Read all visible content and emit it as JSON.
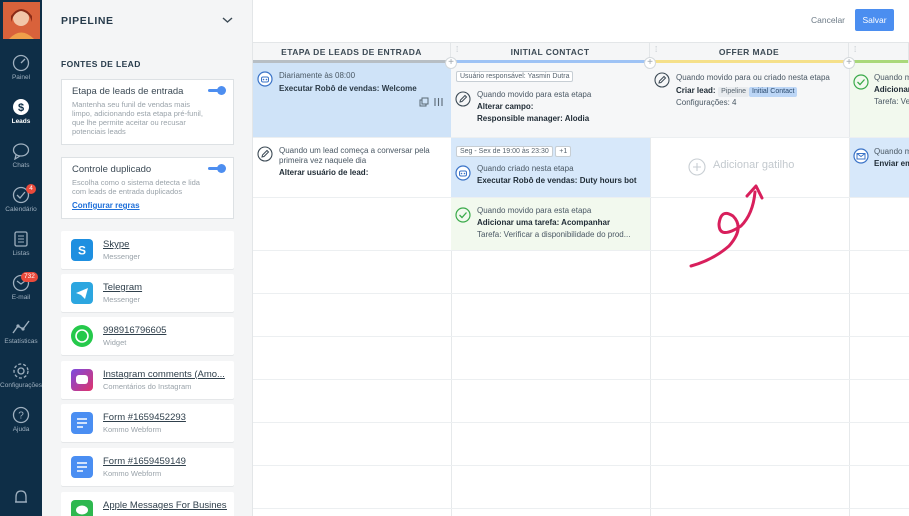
{
  "pipeline": {
    "title": "PIPELINE"
  },
  "nav": [
    {
      "label": "Painel",
      "icon": "dashboard-icon"
    },
    {
      "label": "Leads",
      "icon": "leads-icon",
      "active": true
    },
    {
      "label": "Chats",
      "icon": "chat-icon"
    },
    {
      "label": "Calendário",
      "icon": "calendar-check-icon",
      "badge": "4"
    },
    {
      "label": "Listas",
      "icon": "list-icon"
    },
    {
      "label": "E-mail",
      "icon": "mail-icon",
      "badge": "732"
    },
    {
      "label": "Estatísticas",
      "icon": "stats-icon"
    },
    {
      "label": "Configurações",
      "icon": "settings-icon"
    },
    {
      "label": "Ajuda",
      "icon": "help-icon"
    }
  ],
  "sources": {
    "title": "FONTES DE LEAD",
    "incoming_box": {
      "title": "Etapa de leads de entrada",
      "description": "Mantenha seu funil de vendas mais limpo, adicionando esta etapa pré-funil, que lhe permite aceitar ou recusar potenciais leads"
    },
    "duplicate_box": {
      "title": "Controle duplicado",
      "description": "Escolha como o sistema detecta e lida com leads de entrada duplicados",
      "link": "Configurar regras"
    },
    "items": [
      {
        "name": "Skype",
        "sub": "Messenger",
        "icon": "skype-icon",
        "color": "#1e8fe0"
      },
      {
        "name": "Telegram",
        "sub": "Messenger",
        "icon": "telegram-icon",
        "color": "#2ca6e0"
      },
      {
        "name": "998916796605",
        "sub": "Widget",
        "icon": "whatsapp-icon",
        "color": "#25c94b"
      },
      {
        "name": "Instagram comments (Amo...",
        "sub": "Comentários do Instagram",
        "icon": "instagram-icon",
        "color": "#d63a7a"
      },
      {
        "name": "Form #1659452293",
        "sub": "Kommo Webform",
        "icon": "form-icon",
        "color": "#4a8ef2"
      },
      {
        "name": "Form #1659459149",
        "sub": "Kommo Webform",
        "icon": "form-icon",
        "color": "#4a8ef2"
      },
      {
        "name": "Apple Messages For Business",
        "sub": "",
        "icon": "apple-messages-icon",
        "color": "#2eb84f"
      }
    ]
  },
  "header": {
    "cancel": "Cancelar",
    "save": "Salvar"
  },
  "columns": [
    {
      "title": "ETAPA DE LEADS DE ENTRADA",
      "color": "#b7bec4"
    },
    {
      "title": "INITIAL CONTACT",
      "color": "#9ec3f5"
    },
    {
      "title": "OFFER MADE",
      "color": "#f5e08a"
    },
    {
      "title": "",
      "color": "#a9d87a"
    }
  ],
  "triggers": {
    "c0r0": {
      "line1": "Diariamente às 08:00",
      "line2": "Executar Robô de vendas: Welcome"
    },
    "c0r1": {
      "line1": "Quando um lead começa a conversar pela",
      "line1b": "primeira vez naquele dia",
      "line2": "Alterar usuário de lead:"
    },
    "c1r0": {
      "tag": "Usuário responsável: Yasmin Dutra",
      "line1": "Quando movido para esta etapa",
      "line2": "Alterar campo:",
      "line3": "Responsible manager: Alodia"
    },
    "c1r1": {
      "tag": "Seg - Sex de 19:00 às 23:30",
      "tag2": "+1",
      "line1": "Quando criado nesta etapa",
      "line2": "Executar Robô de vendas: Duty hours bot"
    },
    "c1r2": {
      "line1": "Quando movido para esta etapa",
      "line2": "Adicionar uma tarefa: Acompanhar",
      "line3": "Tarefa: Verificar a disponibilidade do prod..."
    },
    "c2r0": {
      "line1": "Quando movido para ou criado nesta etapa",
      "line2": "Criar lead:",
      "pill1": "Pipeline",
      "pill2": "Initial Contact",
      "line3": "Configurações: 4"
    },
    "c2r1": {
      "add": "Adicionar gatilho"
    },
    "c3r0": {
      "line1": "Quando m",
      "line2": "Adicionar",
      "line3": "Tarefa: Ve"
    },
    "c3r1": {
      "line1": "Quando m",
      "line2": "Enviar em"
    }
  }
}
